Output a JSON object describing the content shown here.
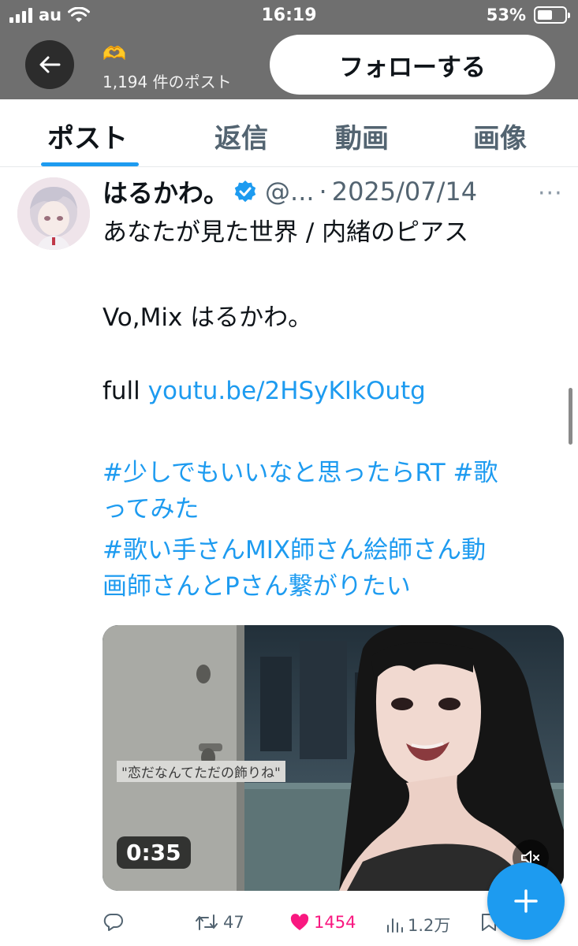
{
  "status_bar": {
    "carrier": "au",
    "time": "16:19",
    "battery": "53%"
  },
  "header": {
    "emoji": "🫶",
    "post_count": "1,194 件のポスト",
    "follow_label": "フォローする"
  },
  "tabs": [
    {
      "label": "ポスト",
      "active": true
    },
    {
      "label": "返信",
      "active": false
    },
    {
      "label": "動画",
      "active": false
    },
    {
      "label": "画像",
      "active": false
    }
  ],
  "post": {
    "author_name": "はるかわ。",
    "handle": "@...",
    "separator": "·",
    "date": "2025/07/14",
    "more": "···",
    "line1": "あなたが見た世界 / 内緒のピアス",
    "line2": "Vo,Mix はるかわ。",
    "full_label": "full",
    "link": "youtu.be/2HSyKIkOutg",
    "hashtag_line1": "#少しでもいいなと思ったらRT #歌",
    "hashtag_line2": "ってみた",
    "hashtag_line3": "#歌い手さんMIX師さん絵師さん動",
    "hashtag_line4": "画師さんとPさん繋がりたい",
    "media": {
      "caption": "\"恋だなんてただの飾りね\"",
      "duration": "0:35"
    },
    "stats": {
      "retweets": "47",
      "likes": "1454",
      "views": "1.2万"
    }
  },
  "colors": {
    "accent": "#1d9bf0",
    "like": "#f91880",
    "header_overlay": "#6f6f6f"
  },
  "icons": [
    "back-arrow-icon",
    "verified-badge-icon",
    "reply-icon",
    "retweet-icon",
    "heart-icon",
    "views-icon",
    "bookmark-icon",
    "mute-icon",
    "plus-icon",
    "wifi-icon",
    "battery-icon"
  ]
}
